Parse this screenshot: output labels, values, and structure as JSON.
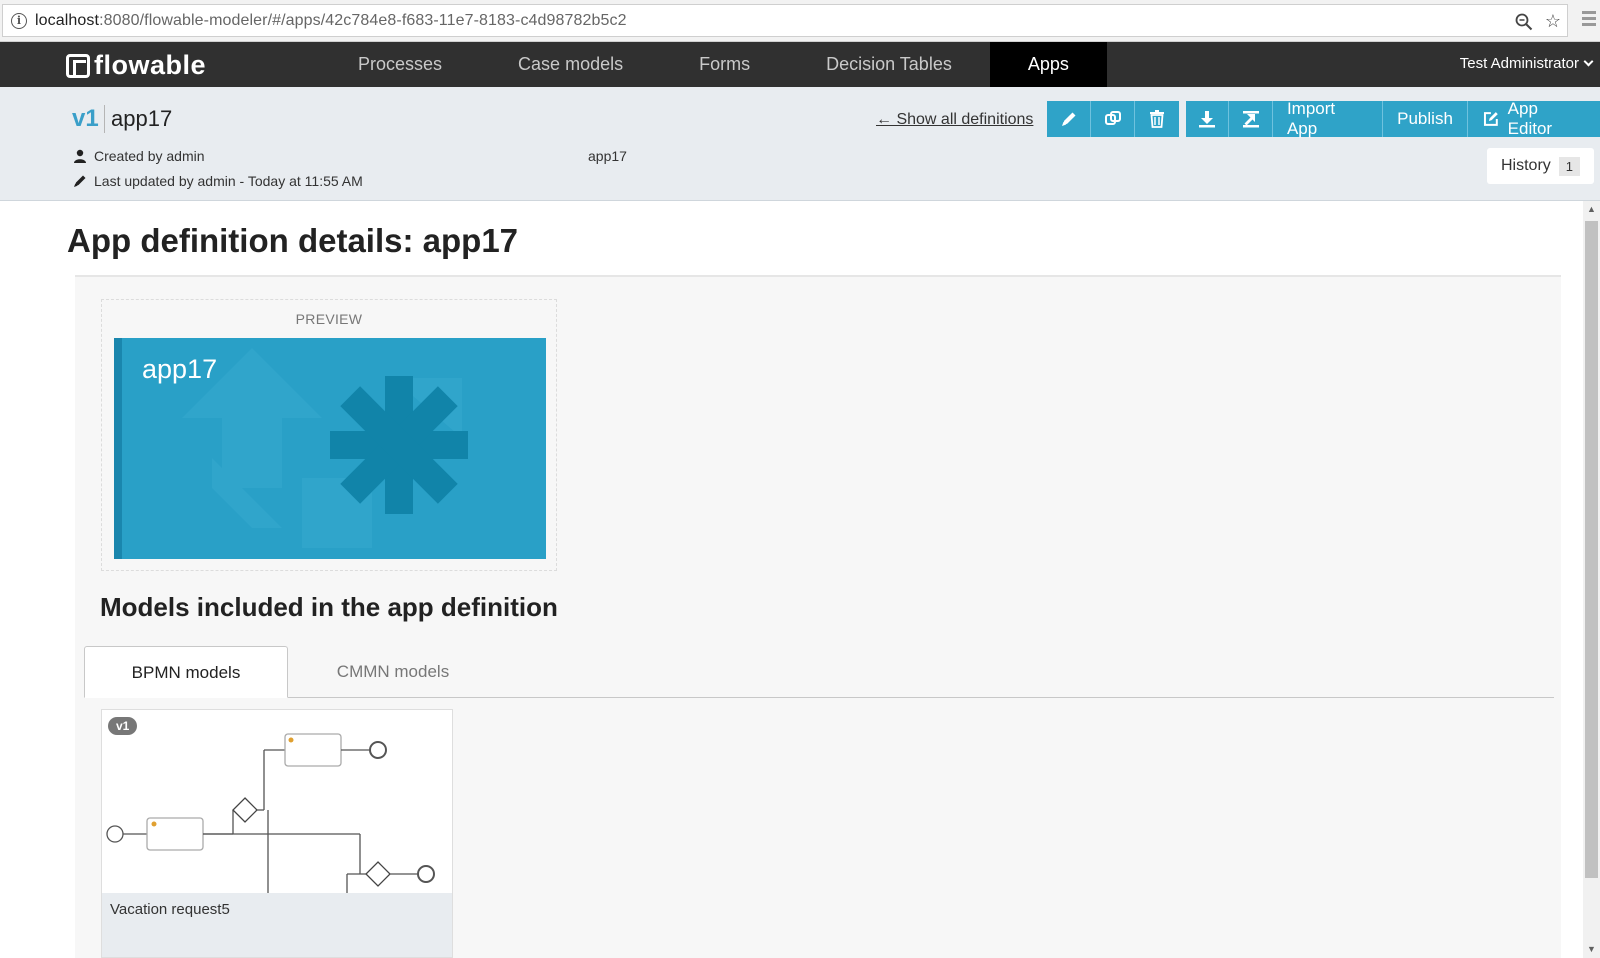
{
  "browser": {
    "url_host": "localhost",
    "url_rest": ":8080/flowable-modeler/#/apps/42c784e8-f683-11e7-8183-c4d98782b5c2"
  },
  "navbar": {
    "logo": "flowable",
    "items": [
      {
        "label": "Processes",
        "active": false
      },
      {
        "label": "Case models",
        "active": false
      },
      {
        "label": "Forms",
        "active": false
      },
      {
        "label": "Decision Tables",
        "active": false
      },
      {
        "label": "Apps",
        "active": true
      }
    ],
    "user": "Test Administrator"
  },
  "header": {
    "version": "v1",
    "name": "app17",
    "created": "Created by admin",
    "updated": "Last updated by admin - Today at 11:55 AM",
    "key": "app17",
    "show_all": "← Show all definitions",
    "buttons": {
      "edit_icon": "pencil-icon",
      "duplicate_icon": "duplicate-icon",
      "delete_icon": "trash-icon",
      "download_icon": "download-icon",
      "export_icon": "export-icon",
      "import": "Import App",
      "publish": "Publish",
      "app_editor": "App Editor"
    },
    "history_label": "History",
    "history_count": "1"
  },
  "main": {
    "title": "App definition details: app17",
    "preview_label": "PREVIEW",
    "tile_name": "app17",
    "tile_color": "#29a0c7",
    "models_heading": "Models included in the app definition",
    "tabs": [
      {
        "label": "BPMN models",
        "active": true
      },
      {
        "label": "CMMN models",
        "active": false
      }
    ],
    "models": [
      {
        "version": "v1",
        "name": "Vacation request5"
      }
    ]
  },
  "colors": {
    "accent": "#2fa3c8",
    "navbar": "#303030",
    "version": "#3a9fc9"
  }
}
